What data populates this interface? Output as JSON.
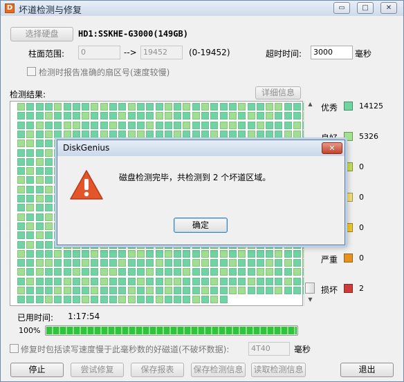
{
  "window": {
    "app_icon": "D",
    "title": "坏道检测与修复",
    "minimize_glyph": "▭",
    "maximize_glyph": "□",
    "close_glyph": "✕"
  },
  "disk": {
    "select_button": "选择硬盘",
    "name": "HD1:SSKHE-G3000(149GB)"
  },
  "range": {
    "label": "柱面范围:",
    "from": "0",
    "arrow": "-->",
    "to": "19452",
    "hint": "(0-19452)",
    "timeout_label": "超时时间:",
    "timeout_value": "3000",
    "timeout_unit": "毫秒"
  },
  "options": {
    "report_sector": "检测时报告准确的扇区号(速度较慢)"
  },
  "results": {
    "label": "检测结果:",
    "detail_button": "详细信息"
  },
  "grid": {
    "cols": 32,
    "rows": 22,
    "last_row_cols": 23,
    "colors": {
      "excellent": "#6fd3a3",
      "good": "#9fde93"
    }
  },
  "legend": [
    {
      "label": "优秀",
      "count": "14125",
      "color": "#6ed59f"
    },
    {
      "label": "良好",
      "count": "5326",
      "color": "#a3e28f"
    },
    {
      "label": "",
      "count": "0",
      "color": "#c8de5a"
    },
    {
      "label": "",
      "count": "0",
      "color": "#f2e07a"
    },
    {
      "label": "",
      "count": "0",
      "color": "#f0c830"
    },
    {
      "label": "严重",
      "count": "0",
      "color": "#e8921e"
    },
    {
      "label": "损坏",
      "count": "2",
      "color": "#d03a3a"
    }
  ],
  "elapsed": {
    "label": "已用时间:",
    "value": "1:17:54"
  },
  "progress": {
    "text": "100%",
    "value": 100
  },
  "repair": {
    "label": "修复时包括读写速度慢于此毫秒数的好磁道(不破坏数据):",
    "value": "4T40",
    "unit": "毫秒"
  },
  "buttons": {
    "stop": "停止",
    "try_repair": "尝试修复",
    "save_report": "保存报表",
    "save_info": "保存检测信息",
    "read_info": "读取检测信息",
    "exit": "退出"
  },
  "dialog": {
    "title": "DiskGenius",
    "message": "磁盘检测完毕，共检测到 2 个坏道区域。",
    "ok": "确定",
    "close_glyph": "✕"
  }
}
